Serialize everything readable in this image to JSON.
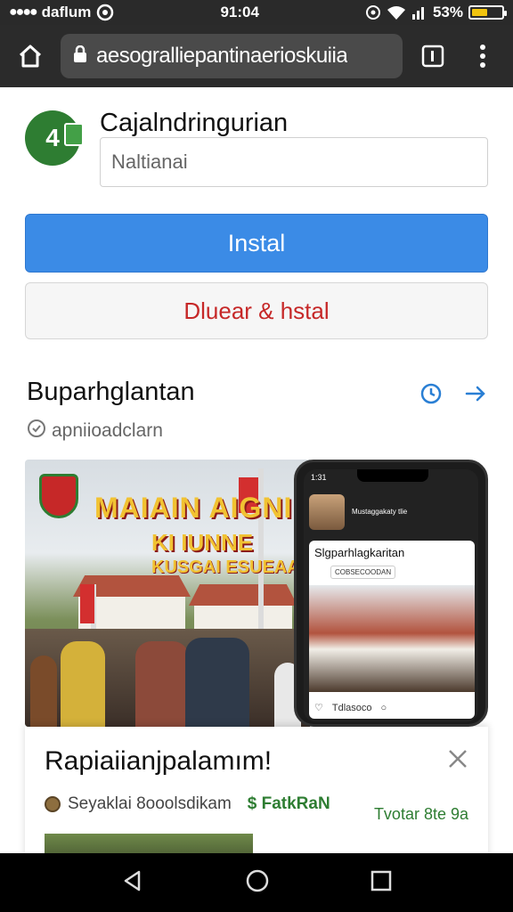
{
  "status_bar": {
    "carrier": "daflum",
    "time": "91:04",
    "battery": "53%",
    "battery_level": 0.53
  },
  "browser": {
    "url": "aesograllie​pantinaerioskuiia",
    "home_icon": "home-icon",
    "lock_icon": "lock-icon",
    "tabs_icon": "tabs-icon",
    "menu_icon": "menu-dots-icon"
  },
  "app": {
    "name": "Cajalndringurian",
    "subtitle": "Naltianai",
    "install_label": "Instal",
    "secondary_label": "Dluear & hstal"
  },
  "section": {
    "title": "Buparhglantan",
    "subtitle": "apniioadclarn"
  },
  "banner": {
    "title_line1": "MAIAIN  AIGNI",
    "title_line2": "KI IUNNE",
    "title_line3": "KUSGAI ESUEAAN",
    "phone_time": "1:31",
    "phone_header": "Mustaggakaty tlie",
    "phone_card_title": "Slgparhlagkaritan",
    "phone_card_tag": "COBSECOODAN",
    "phone_card_footer": "Tdlasoco"
  },
  "sheet": {
    "title": "Rapiaiianjpalamım!",
    "meta_name": "Seyaklai 8ooolsdikam",
    "meta_price": "$ FatkRaN",
    "cta": "Tvotar 8te 9a"
  },
  "colors": {
    "primary_blue": "#3b8be6",
    "danger_red": "#c62828",
    "brand_green": "#2e7d32"
  }
}
